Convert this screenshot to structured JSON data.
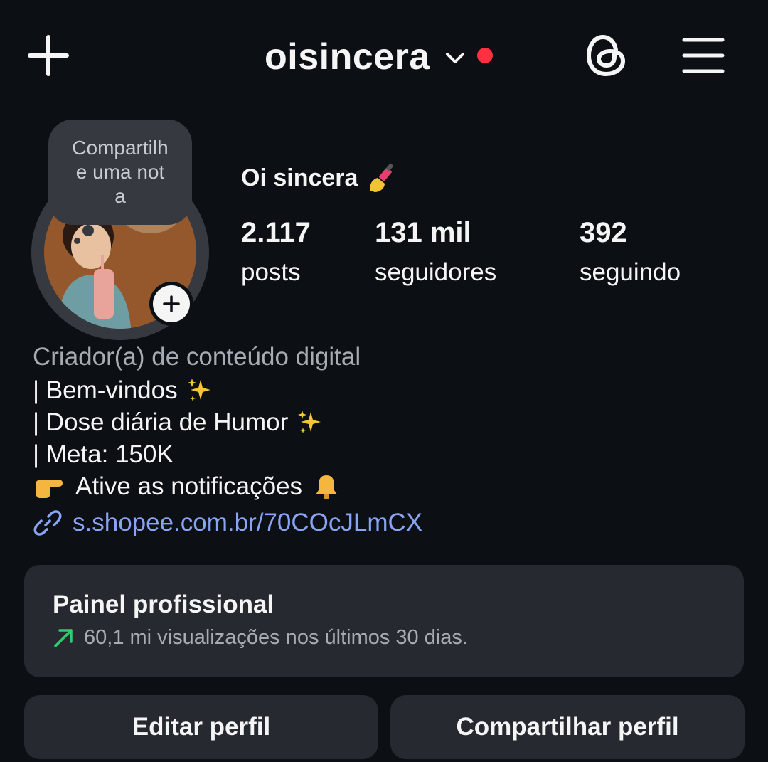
{
  "header": {
    "username": "oisincera",
    "create_icon": "plus-icon",
    "switch_icon": "chevron-down-icon",
    "notification_color": "#ff3040",
    "threads_icon": "threads-icon",
    "menu_icon": "hamburger-menu-icon"
  },
  "note": {
    "text": "Compartilhe uma nota"
  },
  "profile": {
    "display_name": "Oi sincera",
    "name_emoji": "nail-polish-emoji"
  },
  "stats": {
    "posts_count": "2.117",
    "posts_label": "posts",
    "followers_count": "131 mil",
    "followers_label": "seguidores",
    "following_count": "392",
    "following_label": "seguindo"
  },
  "bio": {
    "category": "Criador(a) de conteúdo digital",
    "line1": "| Bem-vindos",
    "line2": "| Dose diária de Humor",
    "line3": "| Meta: 150K",
    "line4": "Ative as notificações",
    "link": "s.shopee.com.br/70COcJLmCX"
  },
  "dashboard": {
    "title": "Painel profissional",
    "subtitle": "60,1 mi visualizações nos últimos 30 dias.",
    "trend_color": "#2ecc71"
  },
  "buttons": {
    "edit_profile": "Editar perfil",
    "share_profile": "Compartilhar perfil"
  },
  "colors": {
    "background": "#0c1014",
    "card": "#262a30",
    "link": "#8aa4f4"
  }
}
